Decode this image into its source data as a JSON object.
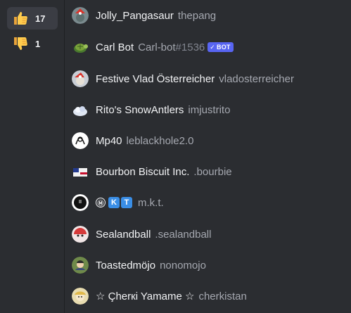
{
  "reactions": [
    {
      "emoji": "thumbs-up",
      "count": "17",
      "selected": true
    },
    {
      "emoji": "thumbs-down",
      "count": "1",
      "selected": false
    }
  ],
  "users": [
    {
      "display": "Jolly_Pangasaur",
      "username": "thepang"
    },
    {
      "display": "Carl Bot",
      "username": "Carl-bot",
      "discriminator": "#1536",
      "tag": "BOT"
    },
    {
      "display": "Festive Vlad Österreicher",
      "username": "vladosterreicher"
    },
    {
      "display": "Rito's SnowAntlers",
      "username": "imjustrito"
    },
    {
      "display": "Mp40",
      "username": "leblackhole2.0"
    },
    {
      "display": "Bourbon Biscuit Inc.",
      "username": ".bourbie"
    },
    {
      "display_prefix": "Ⓜ",
      "display_keys": [
        "K",
        "T"
      ],
      "username": "m.k.t."
    },
    {
      "display": "Sealandball",
      "username": ".sealandball"
    },
    {
      "display": "Toastedmöjo",
      "username": "nonomojo"
    },
    {
      "display": "☆ Çherкi Yamame ☆",
      "username": "cherkistan"
    }
  ],
  "colors": {
    "background": "#2b2d31",
    "hover_row": "#35373c",
    "selected_reaction": "#3b3d44",
    "bot_tag": "#5865f2",
    "muted_text": "#a5a8b0"
  }
}
